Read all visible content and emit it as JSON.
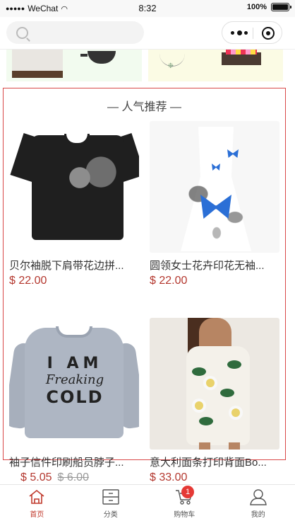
{
  "status_bar": {
    "carrier": "WeChat",
    "time": "8:32",
    "battery": "100%"
  },
  "search": {
    "placeholder": ""
  },
  "section": {
    "title": "— 人气推荐 —"
  },
  "products": [
    {
      "name": "贝尔袖脱下肩带花边拼...",
      "price": "$ 22.00",
      "old_price": ""
    },
    {
      "name": "圆领女士花卉印花无袖...",
      "price": "$ 22.00",
      "old_price": ""
    },
    {
      "name": "袖子信件印刷船员脖子...",
      "price": "$ 5.05",
      "old_price": "$ 6.00"
    },
    {
      "name": "意大利面条打印背面Bo...",
      "price": "$ 33.00",
      "old_price": ""
    }
  ],
  "tabbar": {
    "items": [
      {
        "label": "首页",
        "icon": "home-icon",
        "active": true
      },
      {
        "label": "分类",
        "icon": "category-icon",
        "active": false
      },
      {
        "label": "购物车",
        "icon": "cart-icon",
        "active": false
      },
      {
        "label": "我的",
        "icon": "user-icon",
        "active": false
      }
    ],
    "cart_badge": "1"
  },
  "colors": {
    "accent": "#c0392b",
    "price": "#b4382f",
    "section_border": "#d94848",
    "badge": "#e53935"
  }
}
